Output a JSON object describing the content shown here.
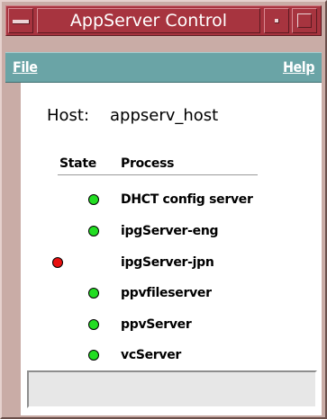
{
  "window": {
    "title": "AppServer Control"
  },
  "menu": {
    "file": "File",
    "help": "Help"
  },
  "host": {
    "label": "Host:",
    "value": "appserv_host"
  },
  "table": {
    "headers": {
      "state": "State",
      "process": "Process"
    },
    "rows": [
      {
        "state": "running",
        "color": "#22dd22",
        "process": "DHCT config server"
      },
      {
        "state": "running",
        "color": "#22dd22",
        "process": "ipgServer-eng"
      },
      {
        "state": "stopped",
        "color": "#e81010",
        "process": "ipgServer-jpn"
      },
      {
        "state": "running",
        "color": "#22dd22",
        "process": "ppvfileserver"
      },
      {
        "state": "running",
        "color": "#22dd22",
        "process": "ppvServer"
      },
      {
        "state": "running",
        "color": "#22dd22",
        "process": "vcServer"
      }
    ]
  },
  "status": {
    "text": ""
  },
  "colors": {
    "titlebar": "#a7343f",
    "menubar": "#6aa4a6",
    "frame": "#c9aca6",
    "running": "#22dd22",
    "stopped": "#e81010"
  }
}
